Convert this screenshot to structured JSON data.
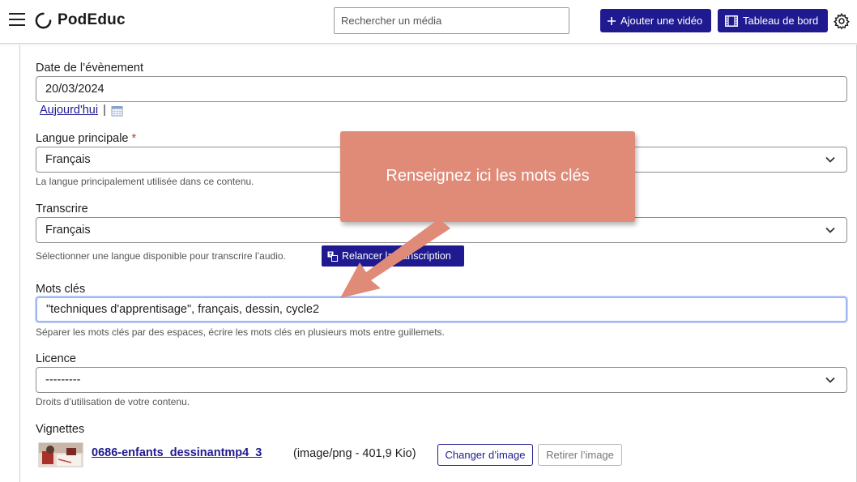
{
  "header": {
    "brand": "PodEduc",
    "search_placeholder": "Rechercher un média",
    "add_video_label": "Ajouter une vidéo",
    "dashboard_label": "Tableau de bord"
  },
  "form": {
    "date": {
      "label": "Date de l’évènement",
      "value": "20/03/2024",
      "today_link": "Aujourd'hui",
      "separator": "|"
    },
    "main_language": {
      "label": "Langue principale",
      "required_mark": "*",
      "value": "Français",
      "help": "La langue principalement utilisée dans ce contenu."
    },
    "transcribe": {
      "label": "Transcrire",
      "value": "Français",
      "help": "Sélectionner une langue disponible pour transcrire l’audio.",
      "relaunch_label": "Relancer la transcription"
    },
    "keywords": {
      "label": "Mots clés",
      "value": "\"techniques d'apprentisage\", français, dessin, cycle2",
      "help": "Séparer les mots clés par des espaces, écrire les mots clés en plusieurs mots entre guillemets."
    },
    "license": {
      "label": "Licence",
      "value": "---------",
      "help": "Droits d’utilisation de votre contenu."
    },
    "thumbnail": {
      "label": "Vignettes",
      "file_name": "0686-enfants_dessinantmp4_3",
      "file_meta": "(image/png - 401,9 Kio)",
      "change_label": "Changer d’image",
      "remove_label": "Retirer l’image"
    }
  },
  "annotation": {
    "text": "Renseignez ici les mots clés",
    "color": "#e08a78"
  },
  "colors": {
    "primary": "#1f1a8f",
    "required": "#c0392b"
  }
}
